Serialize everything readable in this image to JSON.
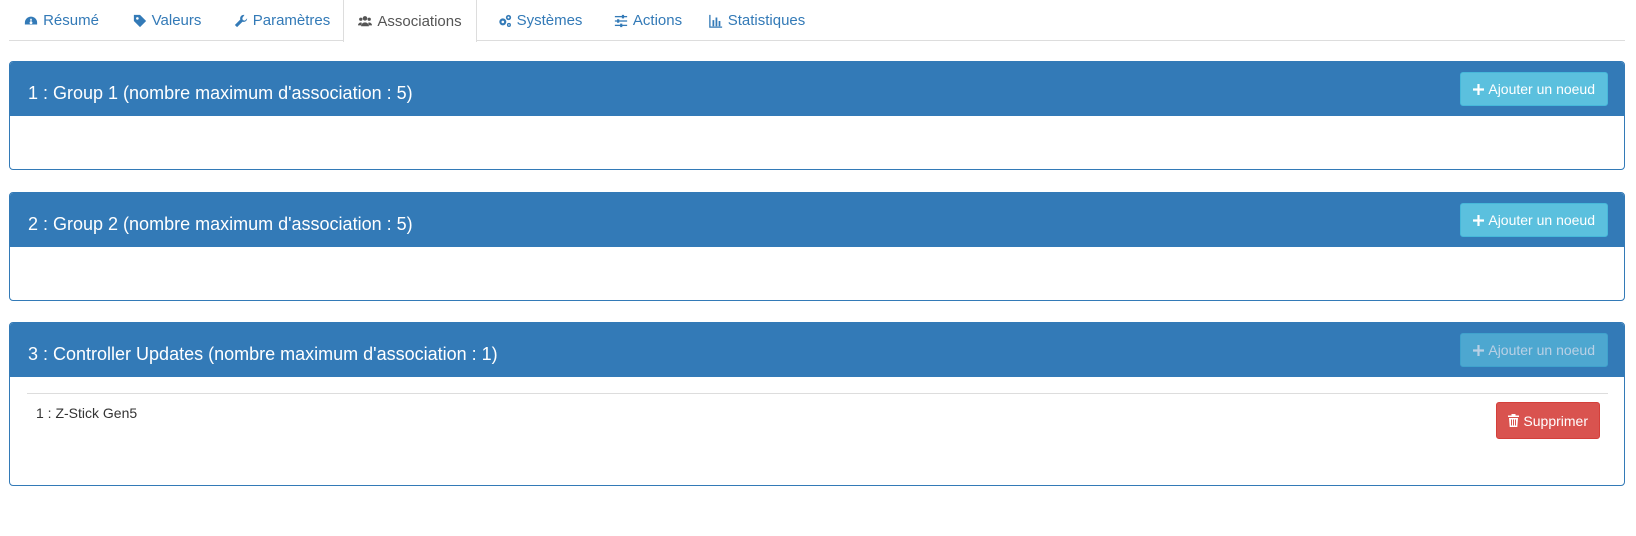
{
  "tabs": [
    {
      "label": "Résumé",
      "icon": "dashboard-icon"
    },
    {
      "label": "Valeurs",
      "icon": "tag-icon"
    },
    {
      "label": "Paramètres",
      "icon": "wrench-icon"
    },
    {
      "label": "Associations",
      "icon": "users-icon",
      "active": true
    },
    {
      "label": "Systèmes",
      "icon": "gears-icon"
    },
    {
      "label": "Actions",
      "icon": "sliders-icon"
    },
    {
      "label": "Statistiques",
      "icon": "bar-chart-icon"
    }
  ],
  "groups": [
    {
      "title": "1 : Group 1 (nombre maximum d'association : 5)",
      "add_label": "Ajouter un noeud",
      "add_disabled": false,
      "nodes": []
    },
    {
      "title": "2 : Group 2 (nombre maximum d'association : 5)",
      "add_label": "Ajouter un noeud",
      "add_disabled": false,
      "nodes": []
    },
    {
      "title": "3 : Controller Updates (nombre maximum d'association : 1)",
      "add_label": "Ajouter un noeud",
      "add_disabled": true,
      "nodes": [
        {
          "label": "1 : Z-Stick Gen5",
          "delete_label": "Supprimer"
        }
      ]
    }
  ],
  "colors": {
    "primary": "#337ab7",
    "info": "#5bc0de",
    "danger": "#d9534f",
    "link": "#337ab7"
  }
}
